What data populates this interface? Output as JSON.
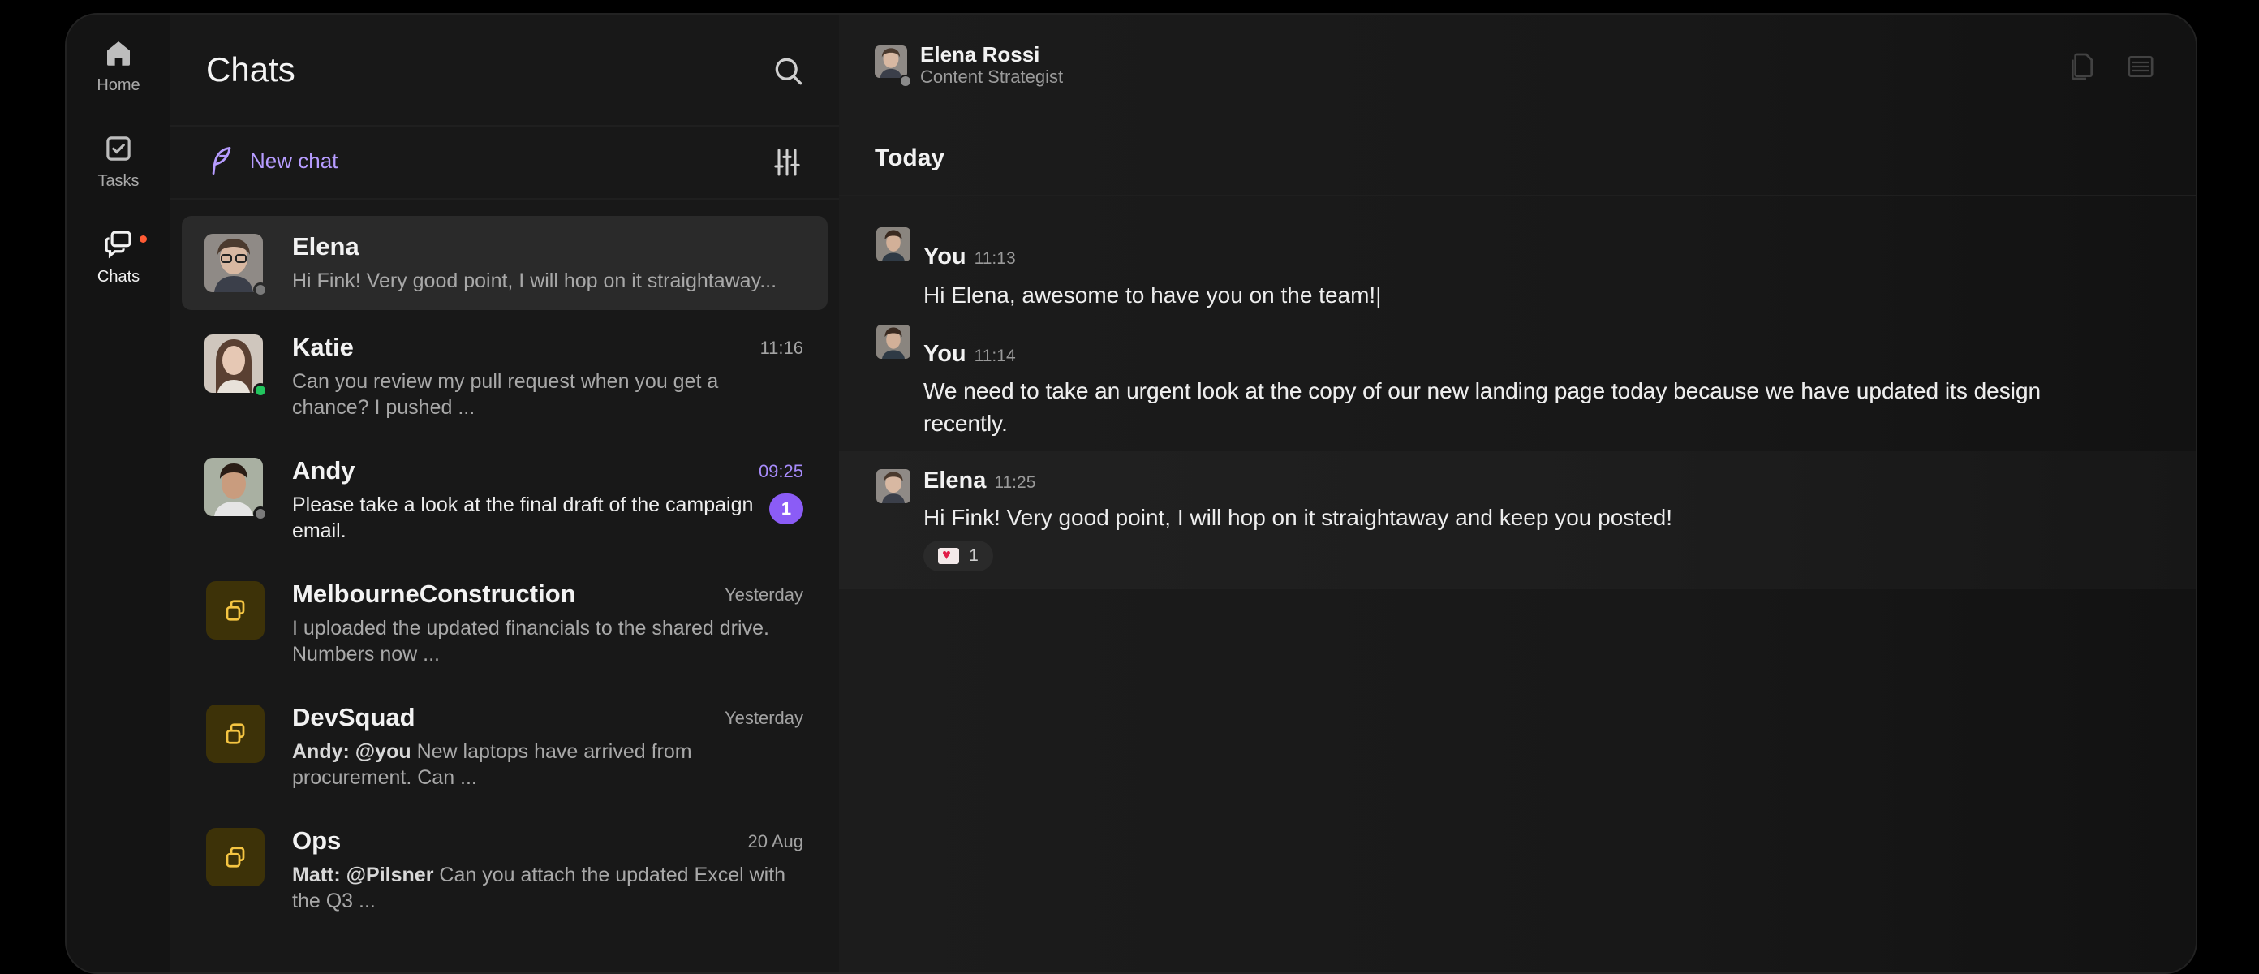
{
  "rail": {
    "items": [
      {
        "label": "Home",
        "icon": "home-icon"
      },
      {
        "label": "Tasks",
        "icon": "tasks-icon"
      },
      {
        "label": "Chats",
        "icon": "chats-icon"
      }
    ],
    "chats_notification_color": "#ff5b34"
  },
  "chat_list": {
    "title": "Chats",
    "new_chat_label": "New chat",
    "accent": "#b69cff",
    "items": [
      {
        "name": "Elena",
        "time": "",
        "preview": "Hi Fink! Very good point, I will hop on it straightaway...",
        "status": "offline"
      },
      {
        "name": "Katie",
        "time": "11:16",
        "preview": "Can you review my pull request when you get a chance? I pushed ...",
        "status": "online"
      },
      {
        "name": "Andy",
        "time": "09:25",
        "preview": "Please take a look at the final draft of the campaign email.",
        "status": "offline",
        "unread": "1"
      },
      {
        "name": "MelbourneConstruction",
        "time": "Yesterday",
        "preview": "I uploaded the updated financials to the shared drive. Numbers now ..."
      },
      {
        "name": "DevSquad",
        "time": "Yesterday",
        "preview_sender": "Andy:",
        "preview_mention": "@you",
        "preview": "New laptops have arrived from procurement. Can ..."
      },
      {
        "name": "Ops",
        "time": "20 Aug",
        "preview_sender": "Matt:",
        "preview_mention": "@Pilsner",
        "preview": "Can you attach the updated Excel with the Q3 ..."
      }
    ]
  },
  "conversation": {
    "contact_name": "Elena Rossi",
    "contact_role": "Content Strategist",
    "day_label": "Today",
    "messages": [
      {
        "sender": "You",
        "time": "11:13",
        "text": "Hi Elena, awesome to have you on the team!|"
      },
      {
        "sender": "You",
        "time": "11:14",
        "text": "We need to take an urgent look at the copy of our new landing page today because we have updated its design recently."
      },
      {
        "sender": "Elena",
        "time": "11:25",
        "text": "Hi Fink! Very good point, I will hop on it straightaway and keep you posted!",
        "reaction_count": "1",
        "reaction_icon": "heart-letter-icon"
      }
    ]
  }
}
